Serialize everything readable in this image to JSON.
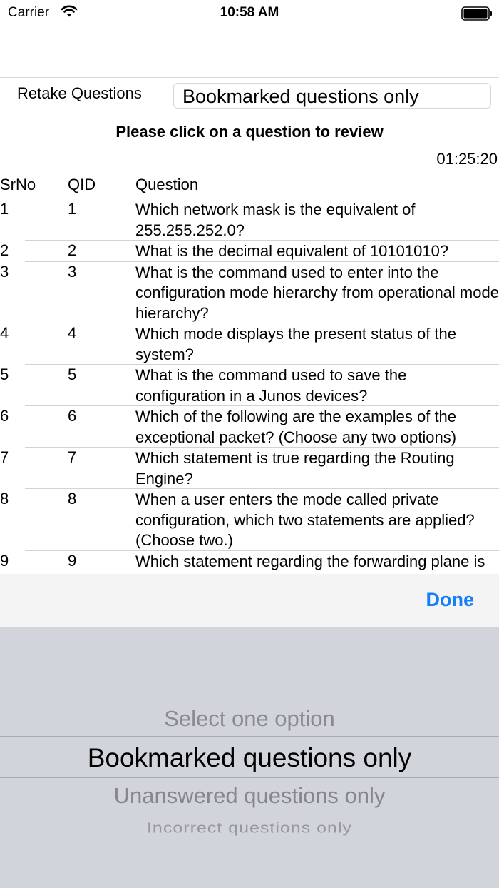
{
  "status_bar": {
    "carrier": "Carrier",
    "time": "10:58 AM"
  },
  "filter": {
    "label": "Retake Questions",
    "selected": "Bookmarked questions only"
  },
  "instruction": "Please click on a question to review",
  "timer": "01:25:20",
  "table": {
    "headers": [
      "SrNo",
      "QID",
      "Question"
    ],
    "rows": [
      {
        "srno": "1",
        "qid": "1",
        "question": "Which network mask is the equivalent of 255.255.252.0?"
      },
      {
        "srno": "2",
        "qid": "2",
        "question": "What is the decimal equivalent of 10101010?"
      },
      {
        "srno": "3",
        "qid": "3",
        "question": "What is the command used to enter into the configuration mode hierarchy from operational mode hierarchy?"
      },
      {
        "srno": "4",
        "qid": "4",
        "question": "Which mode displays the present status of the system?"
      },
      {
        "srno": "5",
        "qid": "5",
        "question": "What is the command used to save the configuration in a Junos devices?"
      },
      {
        "srno": "6",
        "qid": "6",
        "question": "Which of the following are the examples of the exceptional packet? (Choose any two options)"
      },
      {
        "srno": "7",
        "qid": "7",
        "question": "Which statement is true regarding the Routing Engine?"
      },
      {
        "srno": "8",
        "qid": "8",
        "question": "When a user enters the mode called private configuration, which two statements are applied? (Choose two.)"
      },
      {
        "srno": "9",
        "qid": "9",
        "question": "Which statement regarding the forwarding plane is true?"
      }
    ]
  },
  "toolbar": {
    "done_label": "Done",
    "accent": "#147efb"
  },
  "picker": {
    "options": [
      "Select one option",
      "Bookmarked questions only",
      "Unanswered questions only",
      "Incorrect questions only"
    ],
    "selected_index": 1
  }
}
